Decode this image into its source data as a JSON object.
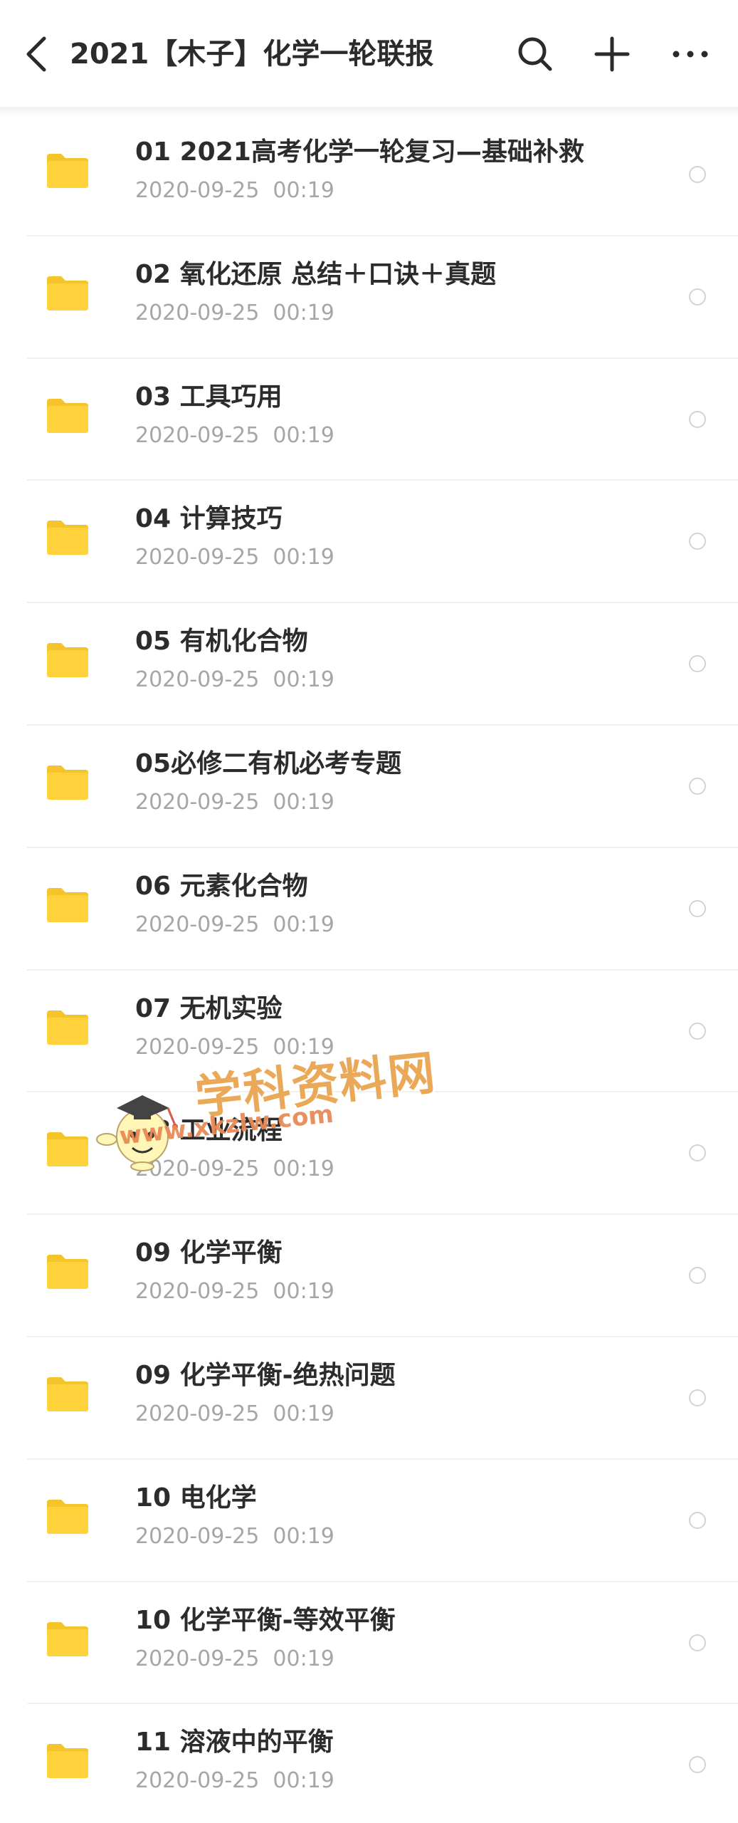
{
  "header": {
    "title": "2021【木子】化学一轮联报",
    "icons": [
      "back-icon",
      "search-icon",
      "add-icon",
      "more-icon"
    ]
  },
  "colors": {
    "folder": "#ffd13a",
    "folder_tab": "#f5c32a",
    "title_text": "#2c2c2c",
    "date_text": "#a6a6a6",
    "divider": "#f0f0f0",
    "watermark": "#e9a24a"
  },
  "items": [
    {
      "title": "01 2021高考化学一轮复习—基础补救",
      "date": "2020-09-25  00:19"
    },
    {
      "title": "02 氧化还原 总结＋口诀＋真题",
      "date": "2020-09-25  00:19"
    },
    {
      "title": "03 工具巧用",
      "date": "2020-09-25  00:19"
    },
    {
      "title": "04 计算技巧",
      "date": "2020-09-25  00:19"
    },
    {
      "title": "05 有机化合物",
      "date": "2020-09-25  00:19"
    },
    {
      "title": "05必修二有机必考专题",
      "date": "2020-09-25  00:19"
    },
    {
      "title": "06 元素化合物",
      "date": "2020-09-25  00:19"
    },
    {
      "title": "07 无机实验",
      "date": "2020-09-25  00:19"
    },
    {
      "title": "08 工业流程",
      "date": "2020-09-25  00:19"
    },
    {
      "title": "09 化学平衡",
      "date": "2020-09-25  00:19"
    },
    {
      "title": "09 化学平衡-绝热问题",
      "date": "2020-09-25  00:19"
    },
    {
      "title": "10 电化学",
      "date": "2020-09-25  00:19"
    },
    {
      "title": "10 化学平衡-等效平衡",
      "date": "2020-09-25  00:19"
    },
    {
      "title": "11 溶液中的平衡",
      "date": "2020-09-25  00:19"
    }
  ],
  "watermark": {
    "text": "学科资料网",
    "url": "www.xkzlw.com"
  }
}
